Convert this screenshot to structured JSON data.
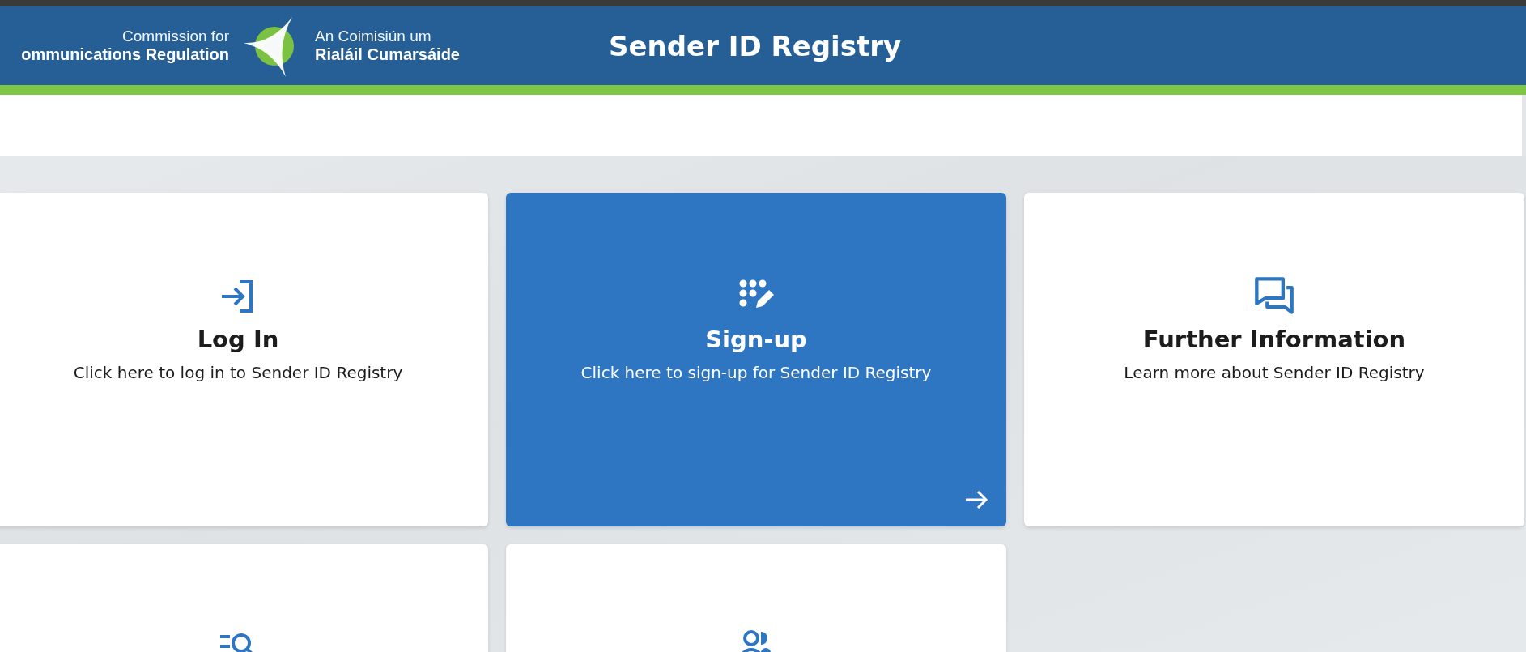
{
  "header": {
    "org_name_en_line1": "Commission for",
    "org_name_en_line2": "ommunications Regulation",
    "org_name_ga_line1": "An Coimisiún um",
    "org_name_ga_line2": "Rialáil Cumarsáide",
    "title": "Sender ID Registry"
  },
  "cards": [
    {
      "title": "Log In",
      "description": "Click here to log in to Sender ID Registry",
      "selected": false
    },
    {
      "title": "Sign-up",
      "description": "Click here to sign-up for Sender ID Registry",
      "selected": true
    },
    {
      "title": "Further Information",
      "description": "Learn more about Sender ID Registry",
      "selected": false
    },
    {
      "selected": false
    },
    {
      "selected": false
    }
  ]
}
